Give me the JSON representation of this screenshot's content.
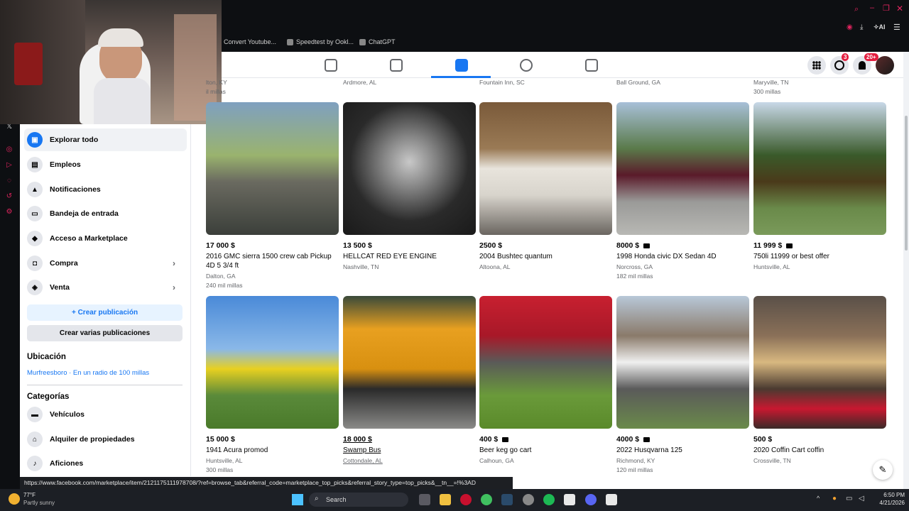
{
  "browser": {
    "bookmarks": [
      {
        "label": "Convert Youtube..."
      },
      {
        "label": "Speedtest by Ookl..."
      },
      {
        "label": "ChatGPT"
      }
    ],
    "ai_label": "AI"
  },
  "fb": {
    "messenger_badge": "3",
    "notif_badge": "20+"
  },
  "sidebar": {
    "items": [
      {
        "label": "Explorar todo",
        "icon": "storefront-icon"
      },
      {
        "label": "Empleos",
        "icon": "briefcase-icon"
      },
      {
        "label": "Notificaciones",
        "icon": "bell-icon"
      },
      {
        "label": "Bandeja de entrada",
        "icon": "inbox-icon"
      },
      {
        "label": "Acceso a Marketplace",
        "icon": "shield-icon"
      },
      {
        "label": "Compra",
        "icon": "bag-icon"
      },
      {
        "label": "Venta",
        "icon": "tag-icon"
      }
    ],
    "create_listing": "Crear publicación",
    "create_multiple": "Crear varias publicaciones",
    "location_heading": "Ubicación",
    "location_value": "Murfreesboro · En un radio de 100 millas",
    "categories_heading": "Categorías",
    "categories": [
      {
        "label": "Vehículos",
        "icon": "car-icon"
      },
      {
        "label": "Alquiler de propiedades",
        "icon": "house-icon"
      },
      {
        "label": "Aficiones",
        "icon": "guitar-icon"
      }
    ]
  },
  "top_row": [
    {
      "loc": "lton, KY",
      "mil": "il millas"
    },
    {
      "loc": "Ardmore, AL",
      "mil": ""
    },
    {
      "loc": "Fountain Inn, SC",
      "mil": ""
    },
    {
      "loc": "Ball Ground, GA",
      "mil": ""
    },
    {
      "loc": "Maryville, TN",
      "mil": "300 millas"
    }
  ],
  "row1": [
    {
      "price": "17 000 $",
      "title": "2016 GMC sierra 1500 crew cab Pickup 4D 5 3/4 ft",
      "loc": "Dalton, GA",
      "mil": "240 mil millas",
      "video": false
    },
    {
      "price": "13 500 $",
      "title": "HELLCAT RED EYE ENGINE",
      "loc": "Nashville, TN",
      "mil": "",
      "video": false
    },
    {
      "price": "2500 $",
      "title": "2004 Bushtec quantum",
      "loc": "Altoona, AL",
      "mil": "",
      "video": false
    },
    {
      "price": "8000 $",
      "title": "1998 Honda civic DX Sedan 4D",
      "loc": "Norcross, GA",
      "mil": "182 mil millas",
      "video": true
    },
    {
      "price": "11 999 $",
      "title": "750li 11999 or best offer",
      "loc": "Huntsville, AL",
      "mil": "",
      "video": true
    }
  ],
  "row2": [
    {
      "price": "15 000 $",
      "title": "1941 Acura promod",
      "loc": "Huntsville, AL",
      "mil": "300 millas",
      "video": false
    },
    {
      "price": "18 000 $",
      "title": "Swamp Bus",
      "loc": "Cottondale, AL",
      "mil": "",
      "video": false
    },
    {
      "price": "400 $",
      "title": "Beer keg go cart",
      "loc": "Calhoun, GA",
      "mil": "",
      "video": true
    },
    {
      "price": "4000 $",
      "title": "2022 Husqvarna 125",
      "loc": "Richmond, KY",
      "mil": "120 mil millas",
      "video": true
    },
    {
      "price": "500 $",
      "title": "2020 Coffin Cart coffin",
      "loc": "Crossville, TN",
      "mil": "",
      "video": false
    }
  ],
  "status_url": "https://www.facebook.com/marketplace/item/2121175111978708/?ref=browse_tab&referral_code=marketplace_top_picks&referral_story_type=top_picks&__tn__=!%3AD",
  "taskbar": {
    "weather_temp": "77°F",
    "weather_desc": "Partly sunny",
    "search": "Search",
    "time": "6:50 PM",
    "date": "4/21/2026"
  }
}
